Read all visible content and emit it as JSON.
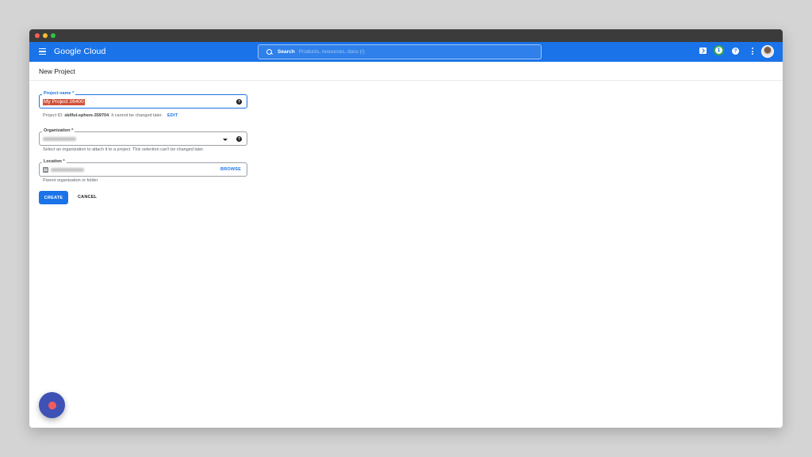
{
  "window": {
    "traffic_lights": [
      "#ff5f57",
      "#febc2e",
      "#28c840"
    ]
  },
  "header": {
    "brand": "Google Cloud",
    "search": {
      "label": "Search",
      "placeholder": "Products, resources, docs (/)"
    },
    "notification_count": "1",
    "help_glyph": "?",
    "icons": [
      "menu-icon",
      "search-icon",
      "terminal-icon",
      "help-icon",
      "more-vert-icon",
      "avatar"
    ],
    "colors": {
      "appbar": "#1a73e8",
      "accent": "#1a73e8"
    }
  },
  "page": {
    "title": "New Project"
  },
  "form": {
    "project_name": {
      "label": "Project name *",
      "value": "My Project 26400",
      "help_glyph": "?"
    },
    "project_id_note": {
      "prefix": "Project ID: ",
      "id": "skilful-sphere-359704",
      "suffix": ". It cannot be changed later.",
      "edit_label": "EDIT"
    },
    "organization": {
      "label": "Organization *",
      "help_glyph": "?",
      "helper": "Select an organization to attach it to a project. This selection can't be changed later."
    },
    "location": {
      "label": "Location *",
      "browse_label": "BROWSE",
      "helper": "Parent organization or folder"
    },
    "create_label": "CREATE",
    "cancel_label": "CANCEL"
  }
}
